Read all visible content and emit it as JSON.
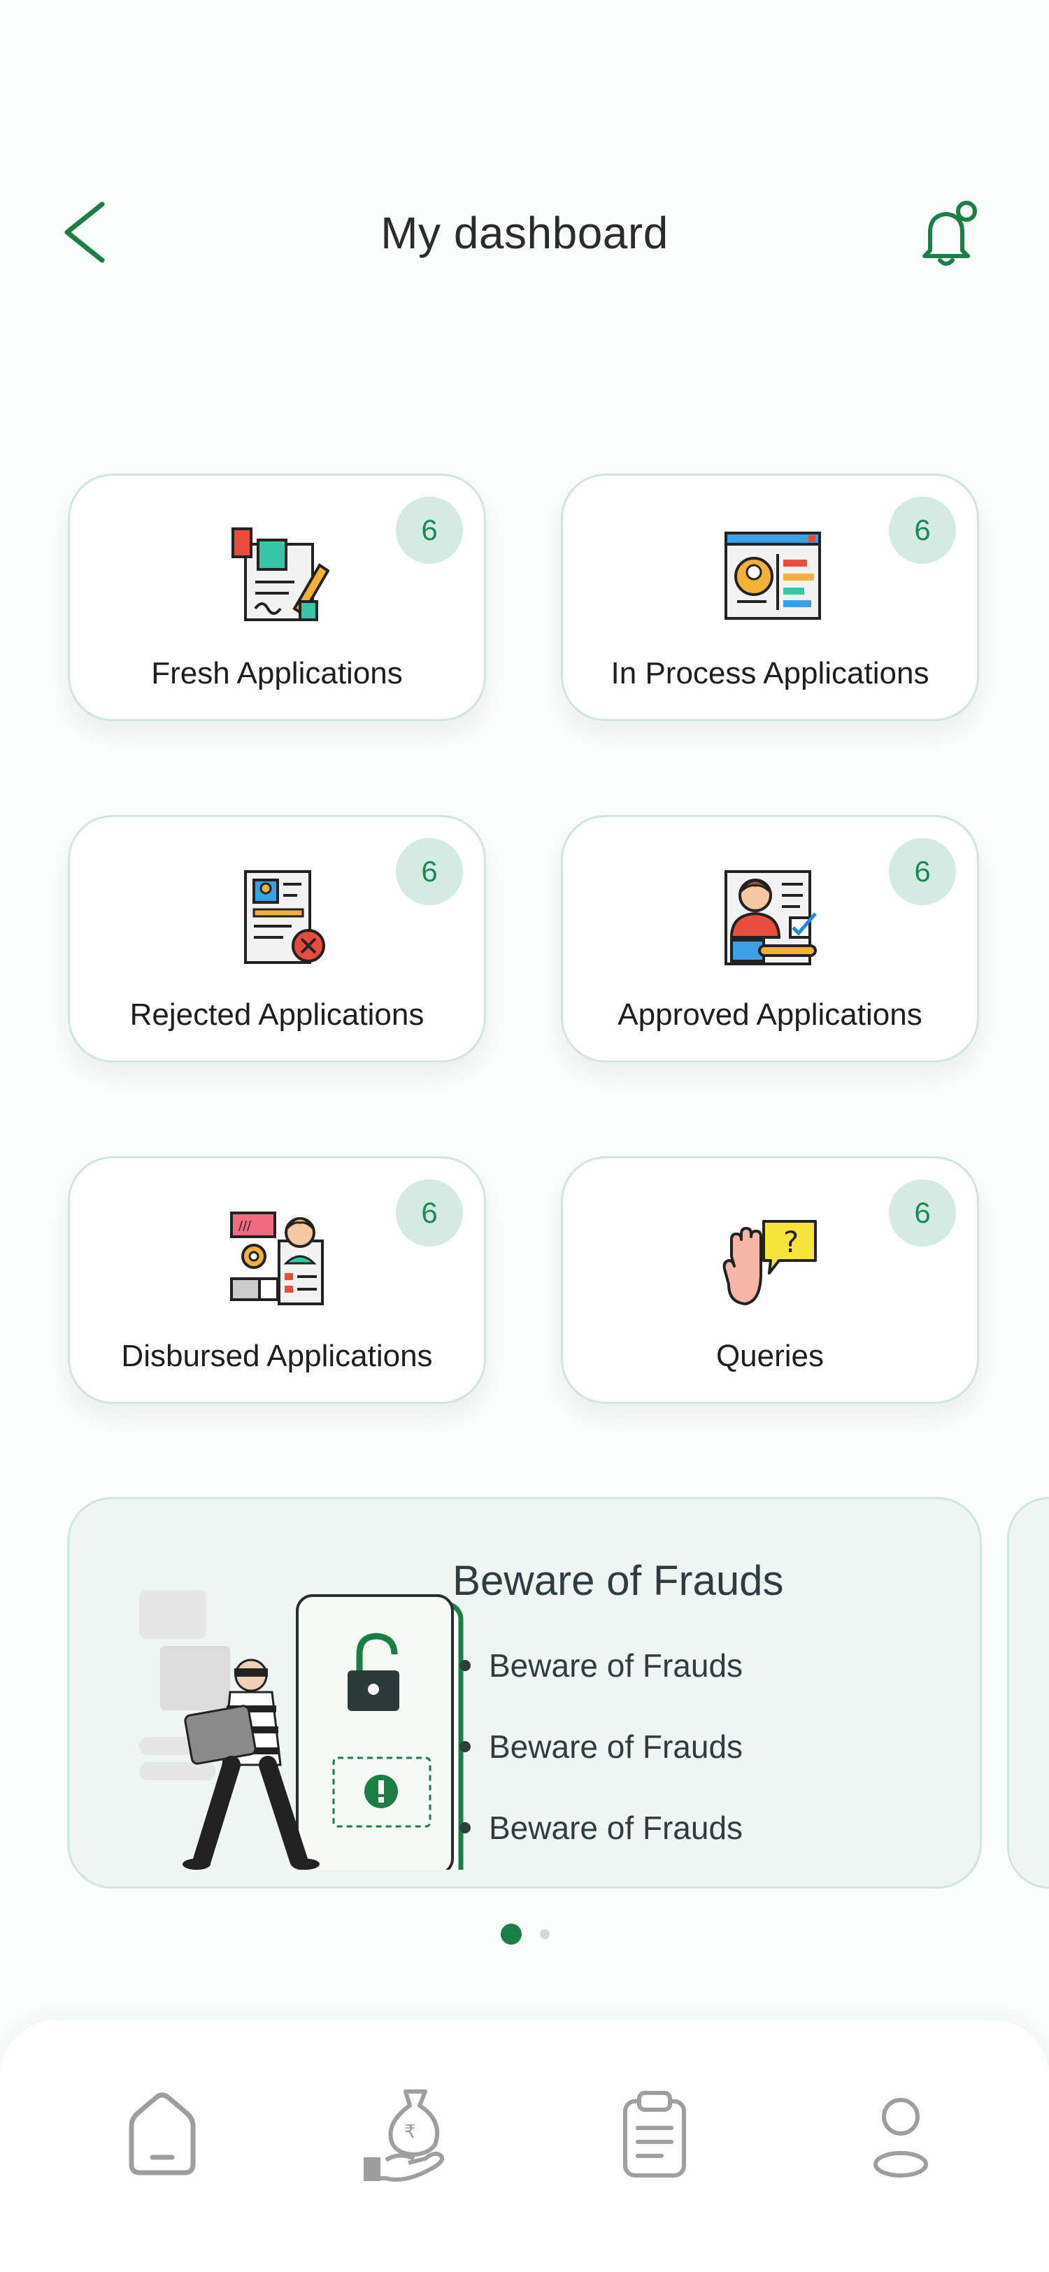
{
  "header": {
    "title": "My dashboard"
  },
  "cards": [
    {
      "label": "Fresh Applications",
      "count": "6",
      "icon": "document-sign-icon"
    },
    {
      "label": "In Process Applications",
      "count": "6",
      "icon": "profile-progress-icon"
    },
    {
      "label": "Rejected Applications",
      "count": "6",
      "icon": "document-rejected-icon"
    },
    {
      "label": "Approved Applications",
      "count": "6",
      "icon": "approved-profile-icon"
    },
    {
      "label": "Disbursed Applications",
      "count": "6",
      "icon": "disbursed-profile-icon"
    },
    {
      "label": "Queries",
      "count": "6",
      "icon": "hand-question-icon"
    }
  ],
  "banner": {
    "title": "Beware of Frauds",
    "points": [
      "Beware of Frauds",
      "Beware of Frauds",
      "Beware of Frauds"
    ]
  },
  "carousel": {
    "active_index": 0,
    "total": 2
  },
  "bottom_nav": [
    {
      "icon": "home-icon"
    },
    {
      "icon": "loan-money-icon"
    },
    {
      "icon": "clipboard-icon"
    },
    {
      "icon": "profile-icon"
    }
  ],
  "colors": {
    "accent": "#1b7f45",
    "badge_bg": "#d3ebe3",
    "card_border": "#cfe6de",
    "banner_bg": "#eef6f3"
  }
}
